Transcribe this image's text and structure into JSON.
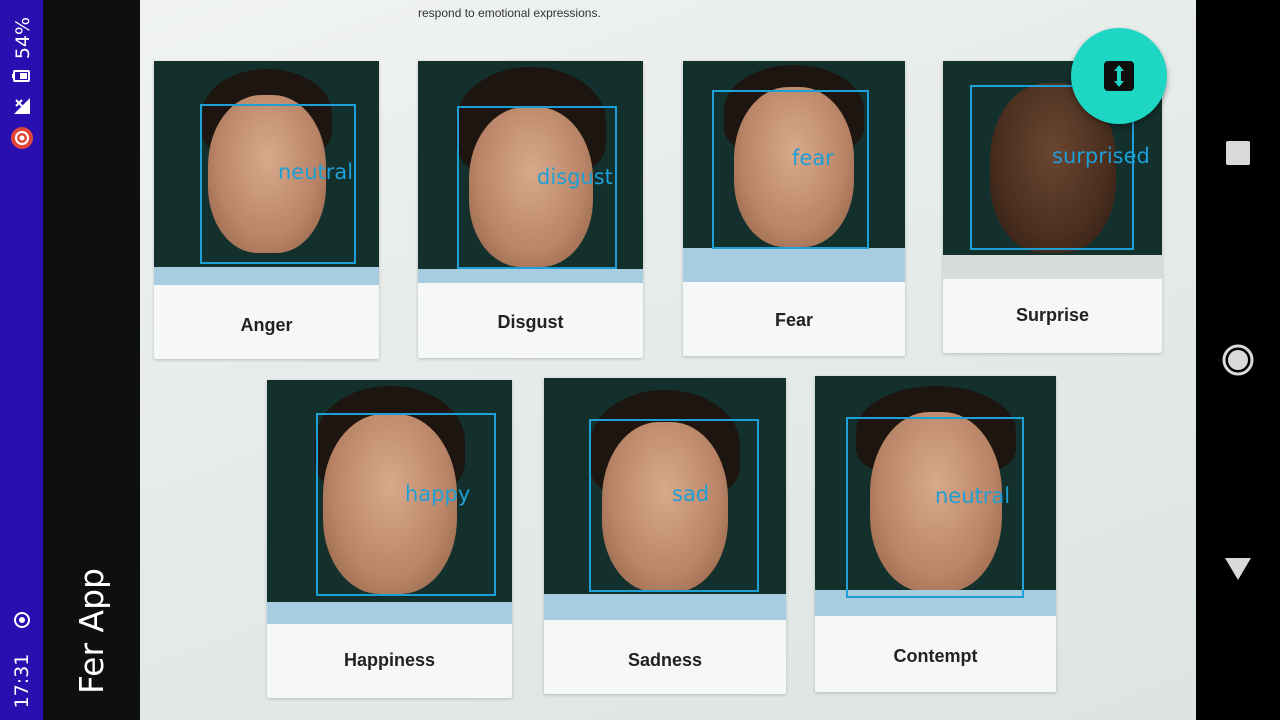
{
  "status_bar": {
    "battery_percent": "54%",
    "time": "17:31"
  },
  "app": {
    "title": "Fer App"
  },
  "page": {
    "header_text": "respond to emotional expressions."
  },
  "cards": [
    {
      "label": "Anger",
      "detection": "neutral"
    },
    {
      "label": "Disgust",
      "detection": "disgust"
    },
    {
      "label": "Fear",
      "detection": "fear"
    },
    {
      "label": "Surprise",
      "detection": "surprised"
    },
    {
      "label": "Happiness",
      "detection": "happy"
    },
    {
      "label": "Sadness",
      "detection": "sad"
    },
    {
      "label": "Contempt",
      "detection": "neutral"
    }
  ],
  "colors": {
    "detection": "#1e9fd6",
    "fab": "#1dd6c3",
    "status_bar": "#2a0fb0"
  },
  "icons": {
    "fab": "switch-camera-icon",
    "nav_recents": "square-icon",
    "nav_home": "circle-icon",
    "nav_back": "triangle-icon"
  }
}
